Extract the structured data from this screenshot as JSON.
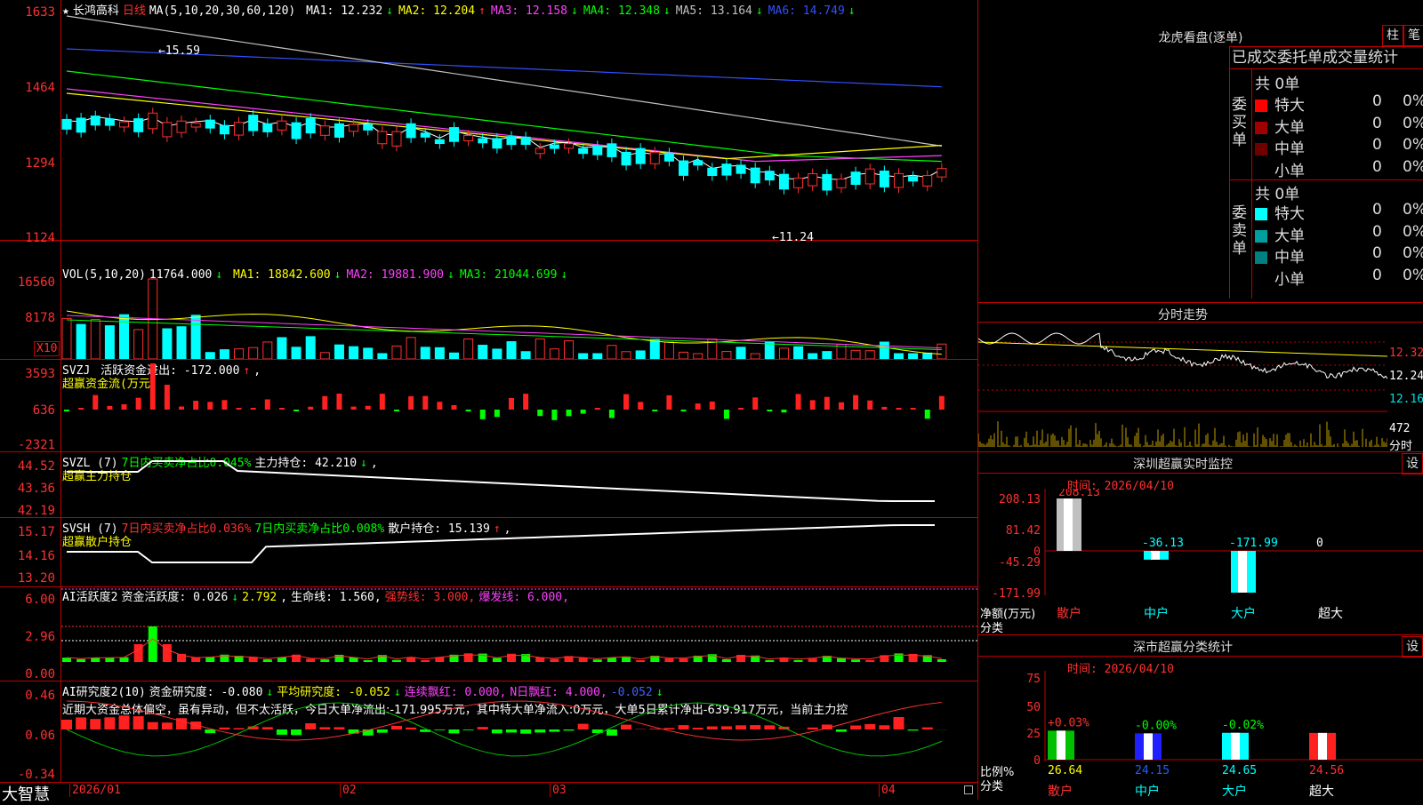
{
  "stock": {
    "star": "★",
    "name": "长鸿高科",
    "period": "日线",
    "ma_params": "MA(5,10,20,30,60,120)",
    "ma": [
      {
        "label": "MA1:",
        "value": "12.232",
        "dir": "↓",
        "color": "#ffffff"
      },
      {
        "label": "MA2:",
        "value": "12.204",
        "dir": "↑",
        "color": "#ffff00"
      },
      {
        "label": "MA3:",
        "value": "12.158",
        "dir": "↓",
        "color": "#ff40ff"
      },
      {
        "label": "MA4:",
        "value": "12.348",
        "dir": "↓",
        "color": "#00ff00"
      },
      {
        "label": "MA5:",
        "value": "13.164",
        "dir": "↓",
        "color": "#c0c0c0"
      },
      {
        "label": "MA6:",
        "value": "14.749",
        "dir": "↓",
        "color": "#3050ff"
      }
    ]
  },
  "price_axis": [
    "1633",
    "1464",
    "1294",
    "1124"
  ],
  "price_markers": {
    "high": "15.59",
    "low": "11.24"
  },
  "vol": {
    "header": "VOL(5,10,20)",
    "value": "11764.000",
    "dir": "↓",
    "ma": [
      {
        "label": "MA1:",
        "value": "18842.600",
        "dir": "↓",
        "color": "#ffff00"
      },
      {
        "label": "MA2:",
        "value": "19881.900",
        "dir": "↓",
        "color": "#ff40ff"
      },
      {
        "label": "MA3:",
        "value": "21044.699",
        "dir": "↓",
        "color": "#00ff00"
      }
    ],
    "axis": [
      "16560",
      "8178"
    ],
    "unit": "X10"
  },
  "svzj": {
    "header": "SVZJ",
    "text": "活跃资金进出: -172.000",
    "dir": "↑",
    "suffix": ",",
    "sub": "超赢资金流(万元)",
    "axis": [
      "3593",
      "636",
      "-2321"
    ]
  },
  "svzl": {
    "header": "SVZL (7)",
    "t1": "7日内买卖净占比0.045%",
    "t2": "主力持仓: 42.210",
    "dir": "↓",
    "suffix": ",",
    "sub": "超赢主力持仓",
    "axis": [
      "44.52",
      "43.36",
      "42.19"
    ]
  },
  "svsh": {
    "header": "SVSH (7)",
    "t1": "7日内买卖净占比0.036%",
    "t2": "7日内买卖净占比0.008%",
    "t3": "散户持仓: 15.139",
    "dir": "↑",
    "suffix": ",",
    "sub": "超赢散户持仓",
    "axis": [
      "15.17",
      "14.16",
      "13.20"
    ]
  },
  "ai1": {
    "header": "AI活跃度2",
    "t1": "资金活跃度: 0.026",
    "d1": "↓",
    "t2": "2.792",
    "d2": ",",
    "t3": "生命线: 1.560,",
    "t4": "强势线: 3.000,",
    "t5": "爆发线: 6.000,",
    "axis": [
      "6.00",
      "2.96",
      "0.00"
    ]
  },
  "ai2": {
    "header": "AI研究度2(10)",
    "t1": "资金研究度: -0.080",
    "d1": "↓",
    "t2": "平均研究度: -0.052",
    "d2": "↓",
    "t3": "连续飘红: 0.000,",
    "t4": "N日飘红: 4.000,",
    "t5": "-0.052",
    "d5": "↓",
    "desc": "近期大资金总体偏空，虽有异动，但不太活跃，今日大单净流出:-171.995万元，其中特大单净流入:0万元，大单5日累计净出-639.917万元，当前主力控",
    "axis": [
      "0.46",
      "0.06",
      "-0.34"
    ]
  },
  "date_axis": [
    "2026/01",
    "02",
    "03",
    "04"
  ],
  "brand": "大智慧",
  "dragon": {
    "title": "龙虎看盘(逐单)",
    "btn1": "柱",
    "btn2": "笔",
    "tabs": "已成交委托单成交量统计",
    "buy_label": "委买单",
    "sell_label": "委卖单",
    "buy_total": "共 0单",
    "sell_total": "共 0单",
    "buy_rows": [
      {
        "name": "特大",
        "count": "0",
        "pct": "0%",
        "color": "#ff0000"
      },
      {
        "name": "大单",
        "count": "0",
        "pct": "0%",
        "color": "#a00000"
      },
      {
        "name": "中单",
        "count": "0",
        "pct": "0%",
        "color": "#700000"
      },
      {
        "name": "小单",
        "count": "0",
        "pct": "0%",
        "color": "#000000"
      }
    ],
    "sell_rows": [
      {
        "name": "特大",
        "count": "0",
        "pct": "0%",
        "color": "#00ffff"
      },
      {
        "name": "大单",
        "count": "0",
        "pct": "0%",
        "color": "#00a0a0"
      },
      {
        "name": "中单",
        "count": "0",
        "pct": "0%",
        "color": "#008080"
      },
      {
        "name": "小单",
        "count": "0",
        "pct": "0%",
        "color": "#000000"
      }
    ]
  },
  "intraday": {
    "title": "分时走势",
    "axis": [
      "12.32",
      "12.24",
      "12.16"
    ],
    "vol_label": "472",
    "unit": "分时"
  },
  "monitor": {
    "title": "深圳超赢实时监控",
    "btn": "设",
    "time": "时间: 2026/04/10",
    "axis": [
      "208.13",
      "81.42",
      "0",
      "-45.29",
      "-171.99"
    ],
    "ylabel": "净额(万元)",
    "xlabel": "分类",
    "cats": [
      "散户",
      "中户",
      "大户",
      "超大"
    ],
    "vals": [
      "208.13",
      "-36.13",
      "-171.99",
      "0"
    ]
  },
  "stats": {
    "title": "深市超赢分类统计",
    "btn": "设",
    "time": "时间: 2026/04/10",
    "axis": [
      "75",
      "50",
      "25",
      "0"
    ],
    "ylabel": "比例%",
    "xlabel": "分类",
    "cats": [
      "散户",
      "中户",
      "大户",
      "超大"
    ],
    "changes": [
      "+0.03%",
      "-0.00%",
      "-0.02%",
      ""
    ],
    "vals": [
      "26.64",
      "24.15",
      "24.65",
      "24.56"
    ]
  }
}
